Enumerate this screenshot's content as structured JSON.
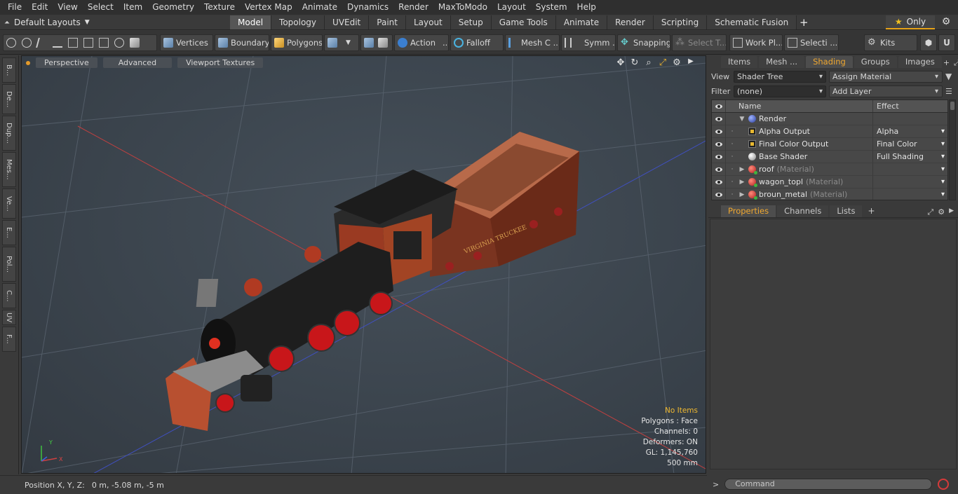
{
  "menu": [
    "File",
    "Edit",
    "View",
    "Select",
    "Item",
    "Geometry",
    "Texture",
    "Vertex Map",
    "Animate",
    "Dynamics",
    "Render",
    "MaxToModo",
    "Layout",
    "System",
    "Help"
  ],
  "layout_selector": "Default Layouts",
  "layout_tabs": [
    {
      "label": "Model",
      "active": true
    },
    {
      "label": "Topology"
    },
    {
      "label": "UVEdit"
    },
    {
      "label": "Paint"
    },
    {
      "label": "Layout"
    },
    {
      "label": "Setup"
    },
    {
      "label": "Game Tools"
    },
    {
      "label": "Animate"
    },
    {
      "label": "Render"
    },
    {
      "label": "Scripting"
    },
    {
      "label": "Schematic Fusion"
    }
  ],
  "add_tab": "+",
  "only_label": "Only",
  "toolbar": {
    "vertices": "Vertices",
    "boundary": "Boundary",
    "polygons": "Polygons",
    "action": "Action",
    "falloff": "Falloff",
    "mesh": "Mesh C ...",
    "symmetry": "Symm ...",
    "snapping": "Snapping",
    "select_through": "Select T...",
    "work_plane": "Work Pl...",
    "selection": "Selecti ...",
    "kits": "Kits"
  },
  "left_strip": [
    "B...",
    "De...",
    "Dup...",
    "Mes...",
    "Ve...",
    "E...",
    "Pol...",
    "C...",
    "UV",
    "F..."
  ],
  "viewport": {
    "view_mode": "Perspective",
    "advanced": "Advanced",
    "textures": "Viewport Textures",
    "stats": {
      "no_items": "No Items",
      "polygons": "Polygons : Face",
      "channels": "Channels: 0",
      "deformers": "Deformers: ON",
      "gl": "GL: 1,145,760",
      "scale": "500 mm"
    },
    "wagon_text": "VIRGINIA TRUCKEE"
  },
  "right_panel": {
    "tabs": [
      {
        "label": "Items"
      },
      {
        "label": "Mesh ..."
      },
      {
        "label": "Shading",
        "active": true
      },
      {
        "label": "Groups"
      },
      {
        "label": "Images"
      }
    ],
    "view_label": "View",
    "view_value": "Shader Tree",
    "assign_material": "Assign Material",
    "filter_label": "Filter",
    "filter_value": "(none)",
    "add_layer": "Add Layer",
    "columns": {
      "name": "Name",
      "effect": "Effect"
    },
    "rows": [
      {
        "name": "Render",
        "effect": "",
        "type": "render",
        "indent": 0,
        "toggle": "▼"
      },
      {
        "name": "Alpha Output",
        "effect": "Alpha",
        "type": "out",
        "indent": 1,
        "toggle": ""
      },
      {
        "name": "Final Color Output",
        "effect": "Final Color",
        "type": "out",
        "indent": 1,
        "toggle": ""
      },
      {
        "name": "Base Shader",
        "effect": "Full Shading",
        "type": "shader",
        "indent": 1,
        "toggle": ""
      },
      {
        "name": "roof",
        "tag": "(Material)",
        "effect": "",
        "type": "mat",
        "indent": 1,
        "toggle": "▶"
      },
      {
        "name": "wagon_topl",
        "tag": "(Material)",
        "effect": "",
        "type": "mat",
        "indent": 1,
        "toggle": "▶"
      },
      {
        "name": "broun_metal",
        "tag": "(Material)",
        "effect": "",
        "type": "mat",
        "indent": 1,
        "toggle": "▶"
      }
    ],
    "props_tabs": [
      {
        "label": "Properties",
        "active": true
      },
      {
        "label": "Channels"
      },
      {
        "label": "Lists"
      }
    ],
    "command_placeholder": "Command"
  },
  "status": {
    "label": "Position X, Y, Z:",
    "value": "0 m, -5.08 m, -5 m"
  },
  "colors": {
    "accent": "#f0a830",
    "viewport_bg": "#3b444d",
    "record": "#d63a3a"
  }
}
